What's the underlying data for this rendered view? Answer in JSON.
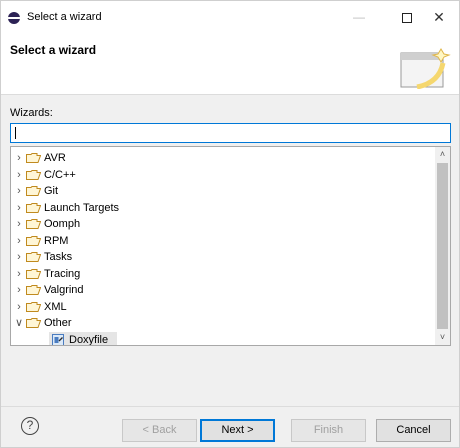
{
  "window": {
    "title": "Select a wizard",
    "minimize_glyph": "—",
    "close_glyph": "✕"
  },
  "banner": {
    "title": "Select a wizard"
  },
  "wizards": {
    "label": "Wizards:",
    "filter_value": "",
    "items": [
      {
        "label": "AVR",
        "expanded": false
      },
      {
        "label": "C/C++",
        "expanded": false
      },
      {
        "label": "Git",
        "expanded": false
      },
      {
        "label": "Launch Targets",
        "expanded": false
      },
      {
        "label": "Oomph",
        "expanded": false
      },
      {
        "label": "RPM",
        "expanded": false
      },
      {
        "label": "Tasks",
        "expanded": false
      },
      {
        "label": "Tracing",
        "expanded": false
      },
      {
        "label": "Valgrind",
        "expanded": false
      },
      {
        "label": "XML",
        "expanded": false
      },
      {
        "label": "Other",
        "expanded": true
      }
    ],
    "child_item": {
      "label": "Doxyfile",
      "selected": true,
      "icon": "doxyfile-icon"
    }
  },
  "buttons": {
    "help_glyph": "?",
    "back": "< Back",
    "next": "Next >",
    "finish": "Finish",
    "cancel": "Cancel"
  },
  "colors": {
    "focus_blue": "#0078d7",
    "folder_outline": "#c08a1e",
    "selection": "#e5e5e5"
  }
}
